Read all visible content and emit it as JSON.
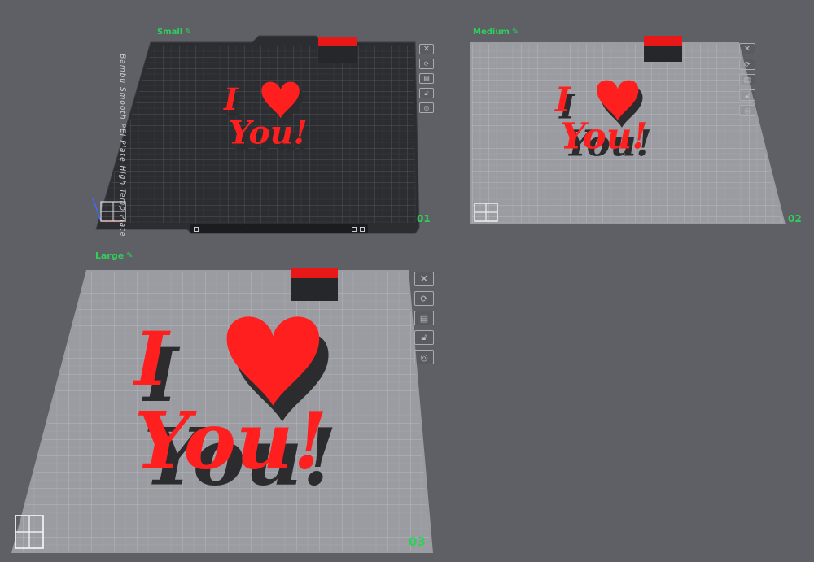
{
  "plates": [
    {
      "name": "Small",
      "number": "01"
    },
    {
      "name": "Medium",
      "number": "02"
    },
    {
      "name": "Large",
      "number": "03"
    }
  ],
  "bed_text": "Bambu Smooth PEI Plate High Temp Plate",
  "model_text": {
    "line1": "I",
    "line2": "You!"
  },
  "icons": {
    "edit": "pencil-icon",
    "tools": [
      "close-icon",
      "auto-orient-icon",
      "arrange-icon",
      "lock-icon",
      "settings-icon"
    ]
  },
  "colors": {
    "accent": "#2fd05a",
    "model_red": "#ff1f1f",
    "model_shadow": "#2c2c2e",
    "dark_bed": "#2c2d31",
    "light_bed": "#9a9ca1"
  }
}
